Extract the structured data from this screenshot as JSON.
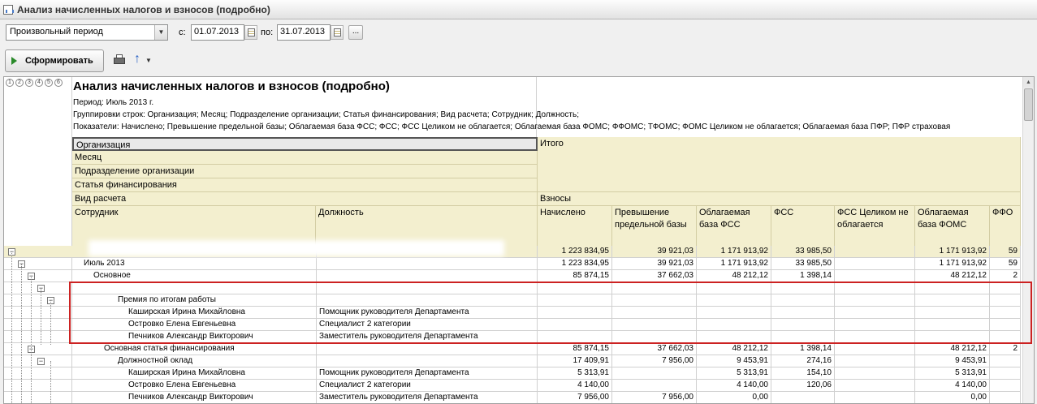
{
  "window": {
    "title": "Анализ начисленных налогов и взносов (подробно)"
  },
  "params": {
    "period_type": "Произвольный период",
    "from_label": "с:",
    "from_date": "01.07.2013",
    "to_label": "по:",
    "to_date": "31.07.2013",
    "more_label": "..."
  },
  "toolbar": {
    "generate_label": "Сформировать"
  },
  "levels": [
    "1",
    "2",
    "3",
    "4",
    "5",
    "6"
  ],
  "report": {
    "title": "Анализ начисленных налогов и взносов (подробно)",
    "period": "Период: Июль 2013 г.",
    "groupings": "Группировки строк: Организация; Месяц; Подразделение организации; Статья финансирования; Вид расчета; Сотрудник; Должность;",
    "indicators": "Показатели: Начислено; Превышение предельной базы; Облагаемая база ФСС; ФСС; ФСС Целиком не облагается; Облагаемая база ФОМС; ФФОМС; ТФОМС; ФОМС Целиком не облагается; Облагаемая база ПФР; ПФР страховая"
  },
  "columns": {
    "org": "Организация",
    "month": "Месяц",
    "dept": "Подразделение организации",
    "fin": "Статья финансирования",
    "calc": "Вид расчета",
    "employee": "Сотрудник",
    "position": "Должность",
    "total": "Итого",
    "contrib": "Взносы",
    "accrued": "Начислено",
    "excess": "Превышение предельной базы",
    "fss_base": "Облагаемая база ФСС",
    "fss": "ФСС",
    "fss_free": "ФСС Целиком не облагается",
    "foms_base": "Облагаемая база ФОМС",
    "ffoms": "ФФО"
  },
  "rows": [
    {
      "label": "",
      "position": "",
      "accrued": "1 223 834,95",
      "excess": "39 921,03",
      "fss_base": "1 171 913,92",
      "fss": "33 985,50",
      "fss_free": "",
      "foms_base": "1 171 913,92",
      "ffoms": "59"
    },
    {
      "label": "Июль 2013",
      "position": "",
      "accrued": "1 223 834,95",
      "excess": "39 921,03",
      "fss_base": "1 171 913,92",
      "fss": "33 985,50",
      "fss_free": "",
      "foms_base": "1 171 913,92",
      "ffoms": "59"
    },
    {
      "label": "Основное",
      "position": "",
      "accrued": "85 874,15",
      "excess": "37 662,03",
      "fss_base": "48 212,12",
      "fss": "1 398,14",
      "fss_free": "",
      "foms_base": "48 212,12",
      "ffoms": "2"
    },
    {
      "label": "",
      "position": "",
      "accrued": "",
      "excess": "",
      "fss_base": "",
      "fss": "",
      "fss_free": "",
      "foms_base": "",
      "ffoms": ""
    },
    {
      "label": "Премия по итогам работы",
      "position": "",
      "accrued": "",
      "excess": "",
      "fss_base": "",
      "fss": "",
      "fss_free": "",
      "foms_base": "",
      "ffoms": ""
    },
    {
      "label": "Каширская Ирина Михайловна",
      "position": "Помощник руководителя Департамента",
      "accrued": "",
      "excess": "",
      "fss_base": "",
      "fss": "",
      "fss_free": "",
      "foms_base": "",
      "ffoms": ""
    },
    {
      "label": "Островко Елена Евгеньевна",
      "position": "Специалист 2 категории",
      "accrued": "",
      "excess": "",
      "fss_base": "",
      "fss": "",
      "fss_free": "",
      "foms_base": "",
      "ffoms": ""
    },
    {
      "label": "Печников  Александр Викторович",
      "position": "Заместитель руководителя Департамента",
      "accrued": "",
      "excess": "",
      "fss_base": "",
      "fss": "",
      "fss_free": "",
      "foms_base": "",
      "ffoms": ""
    },
    {
      "label": "Основная статья финансирования",
      "position": "",
      "accrued": "85 874,15",
      "excess": "37 662,03",
      "fss_base": "48 212,12",
      "fss": "1 398,14",
      "fss_free": "",
      "foms_base": "48 212,12",
      "ffoms": "2"
    },
    {
      "label": "Должностной оклад",
      "position": "",
      "accrued": "17 409,91",
      "excess": "7 956,00",
      "fss_base": "9 453,91",
      "fss": "274,16",
      "fss_free": "",
      "foms_base": "9 453,91",
      "ffoms": ""
    },
    {
      "label": "Каширская Ирина Михайловна",
      "position": "Помощник руководителя Департамента",
      "accrued": "5 313,91",
      "excess": "",
      "fss_base": "5 313,91",
      "fss": "154,10",
      "fss_free": "",
      "foms_base": "5 313,91",
      "ffoms": ""
    },
    {
      "label": "Островко Елена Евгеньевна",
      "position": "Специалист 2 категории",
      "accrued": "4 140,00",
      "excess": "",
      "fss_base": "4 140,00",
      "fss": "120,06",
      "fss_free": "",
      "foms_base": "4 140,00",
      "ffoms": ""
    },
    {
      "label": "Печников  Александр Викторович",
      "position": "Заместитель руководителя Департамента",
      "accrued": "7 956,00",
      "excess": "7 956,00",
      "fss_base": "0,00",
      "fss": "",
      "fss_free": "",
      "foms_base": "0,00",
      "ffoms": ""
    }
  ]
}
